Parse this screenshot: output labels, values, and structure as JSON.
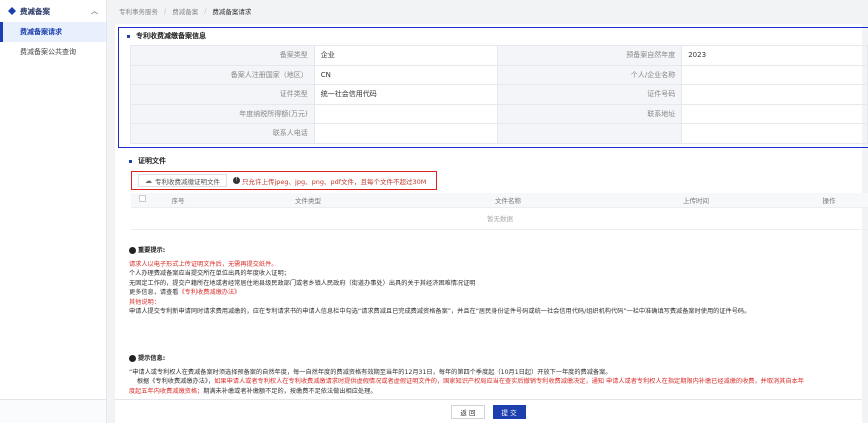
{
  "sidebar": {
    "group_label": "费减备案",
    "items": [
      {
        "label": "费减备案请求",
        "active": true
      },
      {
        "label": "费减备案公共查询",
        "active": false
      }
    ]
  },
  "breadcrumb": [
    "专利事务服务",
    "费减备案",
    "费减备案请求"
  ],
  "info": {
    "title": "专利收费减缴备案信息",
    "rows": [
      {
        "l1": "备案类型",
        "v1": "企业",
        "l2": "预备案自然年度",
        "v2": "2023"
      },
      {
        "l1": "备案人注册国家（地区）",
        "v1": "CN",
        "l2": "个人/企业名称",
        "v2": ""
      },
      {
        "l1": "证件类型",
        "v1": "统一社会信用代码",
        "l2": "证件号码",
        "v2": ""
      },
      {
        "l1": "年度纳税所得额(万元)",
        "v1": "",
        "l2": "联系地址",
        "v2": ""
      },
      {
        "l1": "联系人电话",
        "v1": "",
        "l2": "",
        "v2": ""
      }
    ]
  },
  "proof": {
    "title": "证明文件",
    "upload_label": "专利收费减缴证明文件",
    "upload_hint": "只允许上传jpeg、jpg、png、pdf文件，且每个文件不超过30M",
    "columns": [
      "",
      "序号",
      "文件类型",
      "文件名称",
      "上传时间",
      "操作"
    ],
    "empty_text": "暂无数据"
  },
  "notice": {
    "title": "重要提示:",
    "line1": "请求人以电子形式上传证明文件后，无需再提交纸件。",
    "line2": "个人办理费减备案应当提交所在单位出具的年度收入证明；",
    "line3": "无固定工作的，提交户籍所在地或者经常居住地县级民政部门或者乡镇人民政府（街道办事处）出具的关于其经济困难情况证明",
    "line4_prefix": "更多信息，请查看",
    "line4_link": "《专利收费减缴办法》",
    "line5": "其他说明：",
    "line6": "申请人提交专利新申请同时请求费用减缴的，应在专利请求书的申请人信息栏中勾选“请求费减且已完成费减资格备案”，并且在“居民身份证件号码或统一社会信用代码/组织机构代码”一栏中准确填写费减备案时使用的证件号码。"
  },
  "tips": {
    "title": "提示信息:",
    "line1": "“申请人或专利权人在费减备案时须选择预备案的自然年度，每一自然年度的费减资格有效期至当年的12月31日，每年的第四个季度起（10月1日起）开放下一年度的费减备案。",
    "line2_prefix": "根据《专利收费减缴办法》，",
    "line2_red": "如果申请人或者专利权人在专利收费减缴请求时提供虚假情况或者虚假证明文件的，国家知识产权局应当在查实后撤销专利收费减缴决定，通知 申请人或者专利权人在指定期限内补缴已经减缴的收费，并取消其自本年",
    "line3_red": "度起五年内收费减缴资格；",
    "line3_rest": "期满未补缴或者补缴额不足的，按缴费不足依法做出相应处理。"
  },
  "buttons": {
    "back": "返 回",
    "submit": "提 交"
  }
}
